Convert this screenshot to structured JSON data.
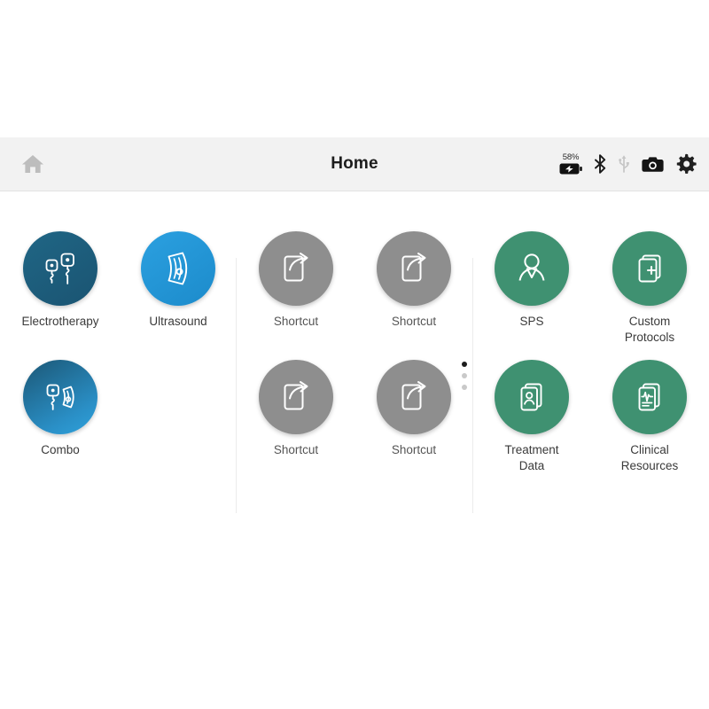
{
  "header": {
    "home_icon": "home-icon",
    "title": "Home",
    "status": {
      "battery_percent": "58%",
      "battery_icon": "battery-charging-icon",
      "bluetooth_icon": "bluetooth-icon",
      "usb_icon": "usb-icon",
      "camera_icon": "camera-icon",
      "settings_icon": "gear-icon"
    }
  },
  "colors": {
    "teal": "#1d5d7e",
    "blue": "#2196d6",
    "green": "#3f9171",
    "grey": "#8e8e8e",
    "header_bg": "#f2f2f2",
    "dot_active": "#1c1c1c",
    "dot_inactive": "#c9c9c9"
  },
  "tiles": {
    "therapy": [
      {
        "label": "Electrotherapy",
        "icon": "electrode-pads-icon",
        "color": "#1d5d7e"
      },
      {
        "label": "Ultrasound",
        "icon": "ultrasound-transducer-icon",
        "color": "#2196d6"
      },
      {
        "label": "Combo",
        "icon": "combo-therapy-icon",
        "color": "#1d5d7e"
      }
    ],
    "shortcuts": [
      {
        "label": "Shortcut",
        "icon": "shortcut-arrow-icon",
        "color": "#8e8e8e"
      },
      {
        "label": "Shortcut",
        "icon": "shortcut-arrow-icon",
        "color": "#8e8e8e"
      },
      {
        "label": "Shortcut",
        "icon": "shortcut-arrow-icon",
        "color": "#8e8e8e"
      },
      {
        "label": "Shortcut",
        "icon": "shortcut-arrow-icon",
        "color": "#8e8e8e"
      }
    ],
    "tools": [
      {
        "label": "SPS",
        "icon": "person-icon",
        "color": "#3f9171"
      },
      {
        "label": "Custom\nProtocols",
        "icon": "documents-plus-icon",
        "color": "#3f9171"
      },
      {
        "label": "Treatment\nData",
        "icon": "patient-records-icon",
        "color": "#3f9171"
      },
      {
        "label": "Clinical\nResources",
        "icon": "waveform-documents-icon",
        "color": "#3f9171"
      }
    ]
  },
  "pagination": {
    "total": 3,
    "active_index": 0
  }
}
